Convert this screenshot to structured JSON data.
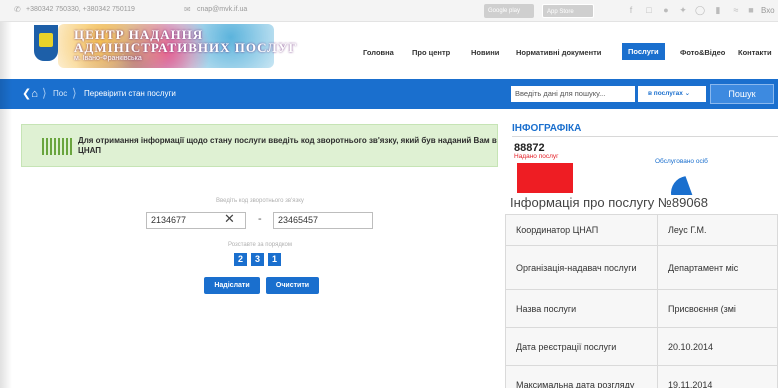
{
  "topbar": {
    "phones": "+380342 750330, +380342 750119",
    "email": "cnap@mvk.if.ua",
    "google_play": "Google play",
    "app_store": "App Store",
    "login": "Вхо"
  },
  "header": {
    "logo_line1": "ЦЕНТР НАДАННЯ",
    "logo_line2": "АДМІНІСТРАТИВНИХ ПОСЛУГ",
    "logo_line3": "м. Івано-Франківська",
    "nav": [
      "Головна",
      "Про центр",
      "Новини",
      "Нормативні документи",
      "Послуги",
      "Фото&Відео",
      "Контакти"
    ],
    "active_nav": "Послуги"
  },
  "breadcrumb": {
    "item1": "Пос",
    "item2": "Перевірити стан послуги"
  },
  "search": {
    "placeholder": "Введіть дані для пошуку...",
    "scope": "в послугах",
    "button": "Пошук"
  },
  "notice": {
    "text": "Для отримання інформації щодо стану послуги введіть код зворотнього зв'язку, який був наданий Вам в ЦНАП"
  },
  "form": {
    "code_label": "Введіть код зворотнього зв'язку",
    "code1": "2134677",
    "code2": "23465457",
    "order_label": "Розставте за порядком",
    "digits": [
      "2",
      "3",
      "1"
    ],
    "submit": "Надіслати",
    "clear": "Очистити"
  },
  "infographic": {
    "title": "ІНФОГРАФІКА",
    "provided_count": "88872",
    "provided_label": "Надано послуг",
    "served_label": "Обслуговано осіб"
  },
  "service_info": {
    "title": "Інформація про послугу №89068",
    "rows": [
      {
        "key": "Координатор ЦНАП",
        "value": "Леус Г.М."
      },
      {
        "key": "Організація-надавач послуги",
        "value": "Департамент міс"
      },
      {
        "key": "Назва послуги",
        "value": "Присвоєння (змі"
      },
      {
        "key": "Дата реєстрації послуги",
        "value": "20.10.2014"
      },
      {
        "key": "Максимальна дата розгляду",
        "value": "19.11.2014"
      }
    ]
  },
  "colors": {
    "primary": "#1a6fce",
    "notice_bg": "#dff1d3",
    "red": "#ee1d23"
  }
}
